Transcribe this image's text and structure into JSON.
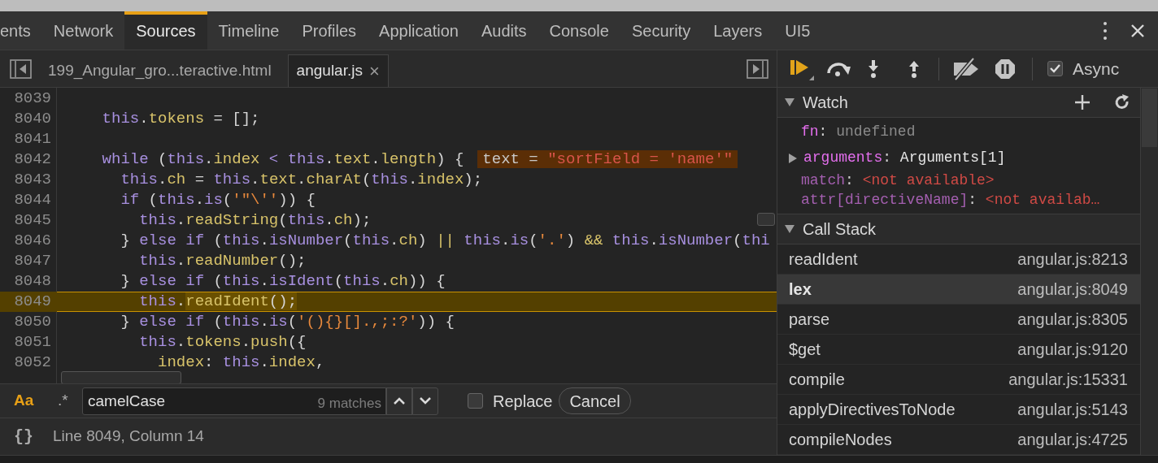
{
  "panel_tabs": [
    {
      "label": "ents",
      "selected": false
    },
    {
      "label": "Network",
      "selected": false
    },
    {
      "label": "Sources",
      "selected": true
    },
    {
      "label": "Timeline",
      "selected": false
    },
    {
      "label": "Profiles",
      "selected": false
    },
    {
      "label": "Application",
      "selected": false
    },
    {
      "label": "Audits",
      "selected": false
    },
    {
      "label": "Console",
      "selected": false
    },
    {
      "label": "Security",
      "selected": false
    },
    {
      "label": "Layers",
      "selected": false
    },
    {
      "label": "UI5",
      "selected": false
    }
  ],
  "file_tabs": [
    {
      "label": "199_Angular_gro...teractive.html",
      "selected": false
    },
    {
      "label": "angular.js",
      "selected": true,
      "close": "×"
    }
  ],
  "code_lines": [
    {
      "number": "8039",
      "current": false
    },
    {
      "number": "8040",
      "current": false,
      "tokens": [
        {
          "kind": "keyword",
          "text": "    this"
        },
        {
          "kind": "plain",
          "text": "."
        },
        {
          "kind": "name",
          "text": "tokens"
        },
        {
          "kind": "plain",
          "text": " = [];"
        }
      ]
    },
    {
      "number": "8041",
      "current": false
    },
    {
      "number": "8042",
      "current": false,
      "tokens": [
        {
          "kind": "keyword",
          "text": "    while"
        },
        {
          "kind": "plain",
          "text": " ("
        },
        {
          "kind": "keyword",
          "text": "this"
        },
        {
          "kind": "plain",
          "text": "."
        },
        {
          "kind": "name",
          "text": "index"
        },
        {
          "kind": "keyword",
          "text": " < this"
        },
        {
          "kind": "plain",
          "text": "."
        },
        {
          "kind": "name",
          "text": "text"
        },
        {
          "kind": "plain",
          "text": "."
        },
        {
          "kind": "name",
          "text": "length"
        },
        {
          "kind": "plain",
          "text": ") {"
        }
      ],
      "inline_value": {
        "name": "text",
        "operator": "=",
        "value": "\"sortField = 'name'\""
      }
    },
    {
      "number": "8043",
      "current": false,
      "tokens": [
        {
          "kind": "keyword",
          "text": "      this"
        },
        {
          "kind": "plain",
          "text": "."
        },
        {
          "kind": "name",
          "text": "ch"
        },
        {
          "kind": "plain",
          "text": " = "
        },
        {
          "kind": "keyword",
          "text": "this"
        },
        {
          "kind": "plain",
          "text": "."
        },
        {
          "kind": "name",
          "text": "text"
        },
        {
          "kind": "plain",
          "text": "."
        },
        {
          "kind": "name",
          "text": "charAt"
        },
        {
          "kind": "plain",
          "text": "("
        },
        {
          "kind": "keyword",
          "text": "this"
        },
        {
          "kind": "plain",
          "text": "."
        },
        {
          "kind": "name",
          "text": "index"
        },
        {
          "kind": "plain",
          "text": ");"
        }
      ]
    },
    {
      "number": "8044",
      "current": false,
      "tokens": [
        {
          "kind": "keyword",
          "text": "      if"
        },
        {
          "kind": "plain",
          "text": " ("
        },
        {
          "kind": "keyword",
          "text": "this"
        },
        {
          "kind": "plain",
          "text": "."
        },
        {
          "kind": "keyword",
          "text": "is"
        },
        {
          "kind": "plain",
          "text": "("
        },
        {
          "kind": "string",
          "text": "'\"\\''"
        },
        {
          "kind": "plain",
          "text": ")) {"
        }
      ]
    },
    {
      "number": "8045",
      "current": false,
      "tokens": [
        {
          "kind": "keyword",
          "text": "        this"
        },
        {
          "kind": "plain",
          "text": "."
        },
        {
          "kind": "name",
          "text": "readString"
        },
        {
          "kind": "plain",
          "text": "("
        },
        {
          "kind": "keyword",
          "text": "this"
        },
        {
          "kind": "plain",
          "text": "."
        },
        {
          "kind": "name",
          "text": "ch"
        },
        {
          "kind": "plain",
          "text": ");"
        }
      ]
    },
    {
      "number": "8046",
      "current": false,
      "tokens": [
        {
          "kind": "plain",
          "text": "      } "
        },
        {
          "kind": "keyword",
          "text": "else"
        },
        {
          "kind": "keyword",
          "text": " if"
        },
        {
          "kind": "plain",
          "text": " ("
        },
        {
          "kind": "keyword",
          "text": "this"
        },
        {
          "kind": "plain",
          "text": "."
        },
        {
          "kind": "keyword",
          "text": "isNumber"
        },
        {
          "kind": "plain",
          "text": "("
        },
        {
          "kind": "keyword",
          "text": "this"
        },
        {
          "kind": "plain",
          "text": "."
        },
        {
          "kind": "name",
          "text": "ch"
        },
        {
          "kind": "plain",
          "text": ") "
        },
        {
          "kind": "name",
          "text": "||"
        },
        {
          "kind": "keyword",
          "text": " this"
        },
        {
          "kind": "plain",
          "text": "."
        },
        {
          "kind": "keyword",
          "text": "is"
        },
        {
          "kind": "plain",
          "text": "("
        },
        {
          "kind": "string",
          "text": "'.'"
        },
        {
          "kind": "plain",
          "text": ") "
        },
        {
          "kind": "name",
          "text": "&&"
        },
        {
          "kind": "keyword",
          "text": " this"
        },
        {
          "kind": "plain",
          "text": "."
        },
        {
          "kind": "keyword",
          "text": "isNumber"
        },
        {
          "kind": "plain",
          "text": "("
        },
        {
          "kind": "keyword",
          "text": "thi"
        }
      ]
    },
    {
      "number": "8047",
      "current": false,
      "tokens": [
        {
          "kind": "keyword",
          "text": "        this"
        },
        {
          "kind": "plain",
          "text": "."
        },
        {
          "kind": "name",
          "text": "readNumber"
        },
        {
          "kind": "plain",
          "text": "();"
        }
      ]
    },
    {
      "number": "8048",
      "current": false,
      "tokens": [
        {
          "kind": "plain",
          "text": "      } "
        },
        {
          "kind": "keyword",
          "text": "else"
        },
        {
          "kind": "keyword",
          "text": " if"
        },
        {
          "kind": "plain",
          "text": " ("
        },
        {
          "kind": "keyword",
          "text": "this"
        },
        {
          "kind": "plain",
          "text": "."
        },
        {
          "kind": "keyword",
          "text": "isIdent"
        },
        {
          "kind": "plain",
          "text": "("
        },
        {
          "kind": "keyword",
          "text": "this"
        },
        {
          "kind": "plain",
          "text": "."
        },
        {
          "kind": "name",
          "text": "ch"
        },
        {
          "kind": "plain",
          "text": ")) {"
        }
      ]
    },
    {
      "number": "8049",
      "current": true,
      "tokens": [
        {
          "kind": "keyword",
          "text": "        this"
        },
        {
          "kind": "plain",
          "text": "."
        },
        {
          "kind": "match",
          "text": "readIdent"
        },
        {
          "kind": "match_plain",
          "text": "();"
        }
      ]
    },
    {
      "number": "8050",
      "current": false,
      "tokens": [
        {
          "kind": "plain",
          "text": "      } "
        },
        {
          "kind": "keyword",
          "text": "else"
        },
        {
          "kind": "keyword",
          "text": " if"
        },
        {
          "kind": "plain",
          "text": " ("
        },
        {
          "kind": "keyword",
          "text": "this"
        },
        {
          "kind": "plain",
          "text": "."
        },
        {
          "kind": "keyword",
          "text": "is"
        },
        {
          "kind": "plain",
          "text": "("
        },
        {
          "kind": "string",
          "text": "'(){}[].,;:?'"
        },
        {
          "kind": "plain",
          "text": ")) {"
        }
      ]
    },
    {
      "number": "8051",
      "current": false,
      "tokens": [
        {
          "kind": "keyword",
          "text": "        this"
        },
        {
          "kind": "plain",
          "text": "."
        },
        {
          "kind": "name",
          "text": "tokens"
        },
        {
          "kind": "plain",
          "text": "."
        },
        {
          "kind": "name",
          "text": "push"
        },
        {
          "kind": "plain",
          "text": "({"
        }
      ]
    },
    {
      "number": "8052",
      "current": false,
      "tokens": [
        {
          "kind": "name",
          "text": "          index"
        },
        {
          "kind": "plain",
          "text": ": "
        },
        {
          "kind": "keyword",
          "text": "this"
        },
        {
          "kind": "plain",
          "text": "."
        },
        {
          "kind": "name",
          "text": "index"
        },
        {
          "kind": "plain",
          "text": ","
        }
      ]
    }
  ],
  "search_bar": {
    "case_toggle": {
      "label": "Aa",
      "on": true
    },
    "regex_toggle": {
      "label": ".*",
      "on": false
    },
    "query": "camelCase",
    "match_count": "9 matches",
    "replace": {
      "label": "Replace",
      "checked": false
    },
    "cancel": "Cancel"
  },
  "status_bar": {
    "format_icon": "{}",
    "position": "Line 8049, Column 14"
  },
  "debugger_toolbar": {
    "async": {
      "label": "Async",
      "checked": true
    }
  },
  "watch": {
    "title": "Watch",
    "expanded": true,
    "items": [
      {
        "kind": "defined",
        "name": "fn",
        "separator": ":",
        "value": "undefined"
      },
      {
        "kind": "object",
        "name": "arguments",
        "separator": ":",
        "value": "Arguments[1]",
        "expanded": false
      },
      {
        "kind": "unavailable",
        "name": "match",
        "separator": ":",
        "value": "<not available>"
      },
      {
        "kind": "unavailable",
        "name": "attr[directiveName]",
        "separator": ":",
        "value": "<not availab…"
      }
    ]
  },
  "call_stack": {
    "title": "Call Stack",
    "expanded": true,
    "frames": [
      {
        "function": "readIdent",
        "location": "angular.js:8213",
        "selected": false
      },
      {
        "function": "lex",
        "location": "angular.js:8049",
        "selected": true
      },
      {
        "function": "parse",
        "location": "angular.js:8305",
        "selected": false
      },
      {
        "function": "$get",
        "location": "angular.js:9120",
        "selected": false
      },
      {
        "function": "compile",
        "location": "angular.js:15331",
        "selected": false
      },
      {
        "function": "applyDirectivesToNode",
        "location": "angular.js:5143",
        "selected": false
      },
      {
        "function": "compileNodes",
        "location": "angular.js:4725",
        "selected": false
      }
    ]
  }
}
